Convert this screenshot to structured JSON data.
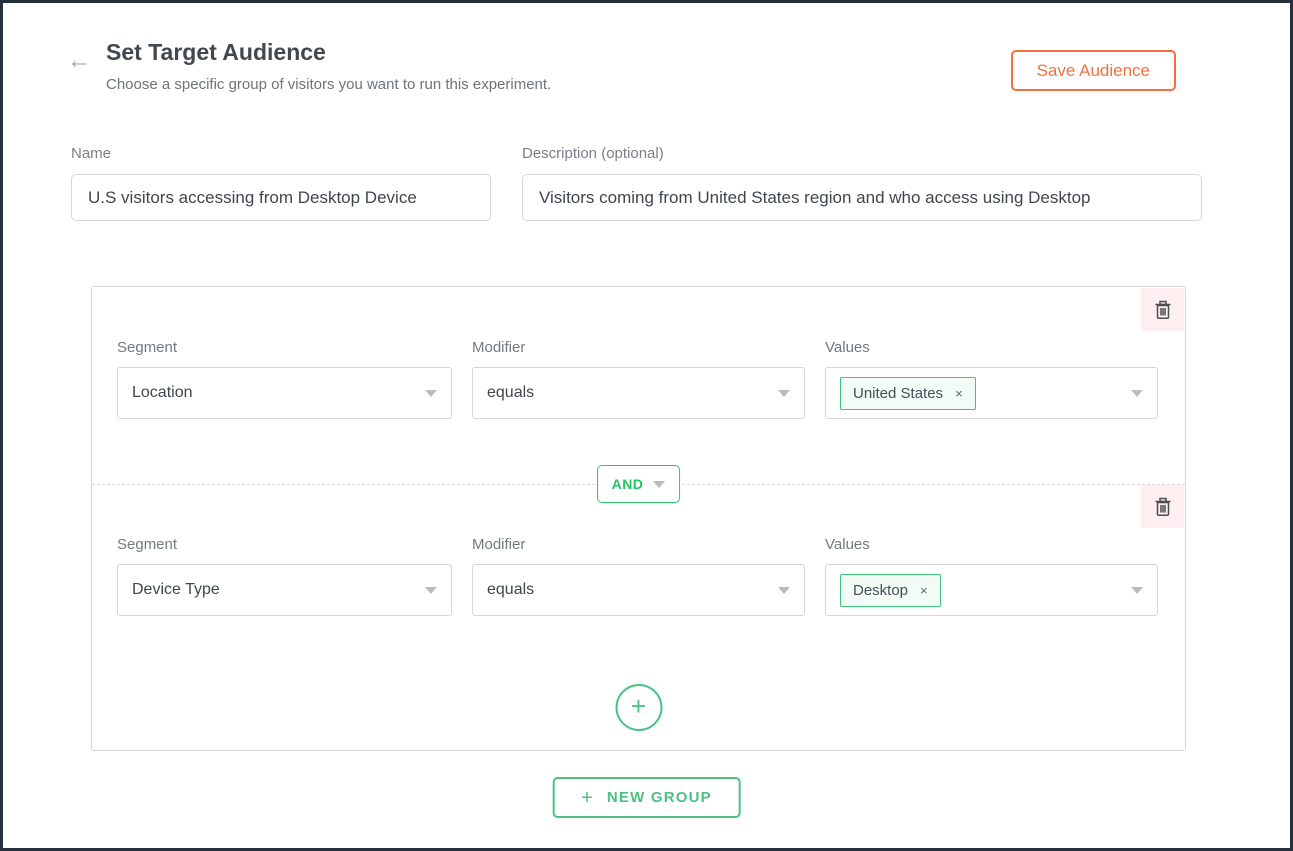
{
  "header": {
    "back_icon": "←",
    "title": "Set Target Audience",
    "subtitle": "Choose a specific group of visitors you want to run this experiment.",
    "save_label": "Save Audience"
  },
  "form": {
    "name": {
      "label": "Name",
      "value": "U.S visitors accessing from Desktop Device"
    },
    "description": {
      "label": "Description (optional)",
      "value": "Visitors coming from United States region and who access using Desktop"
    }
  },
  "group": {
    "operator": "AND",
    "conditions": [
      {
        "segment_label": "Segment",
        "segment_value": "Location",
        "modifier_label": "Modifier",
        "modifier_value": "equals",
        "values_label": "Values",
        "tag": {
          "text": "United States",
          "remove_icon": "×"
        }
      },
      {
        "segment_label": "Segment",
        "segment_value": "Device Type",
        "modifier_label": "Modifier",
        "modifier_value": "equals",
        "values_label": "Values",
        "tag": {
          "text": "Desktop",
          "remove_icon": "×"
        }
      }
    ],
    "add_condition_icon": "+"
  },
  "footer": {
    "new_group_plus": "+",
    "new_group_label": "NEW GROUP"
  },
  "colors": {
    "accent_orange": "#f2713b",
    "accent_green": "#3ec57c",
    "and_text_green": "#21c564",
    "trash_bg_pink": "#fdeef0",
    "frame_dark": "#27303d",
    "text_dark": "#41484f",
    "text_gray": "#74797e",
    "border_gray": "#d4d6d9"
  }
}
